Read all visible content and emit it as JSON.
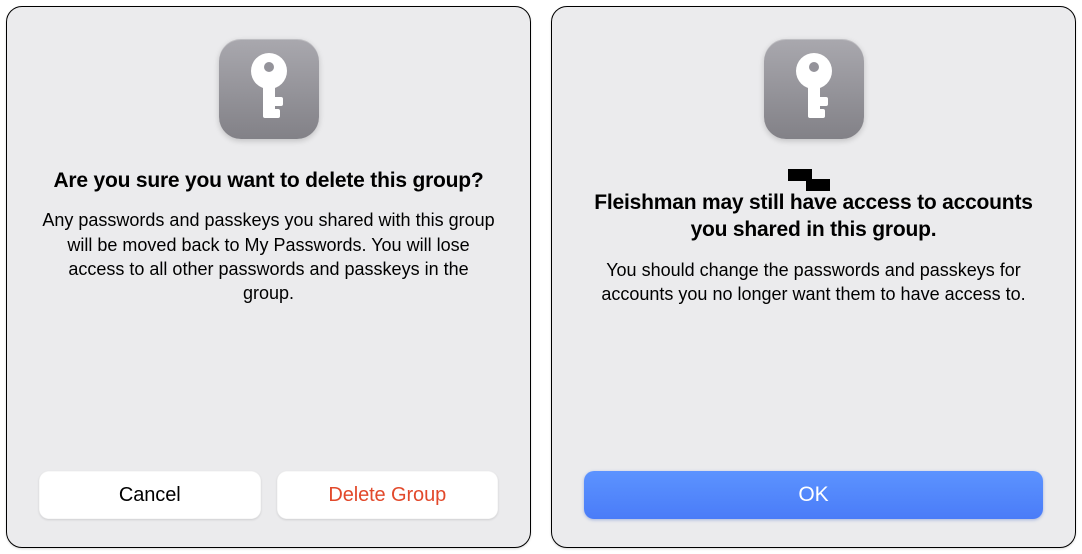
{
  "icons": {
    "app_icon_name": "key-icon"
  },
  "dialog_left": {
    "title": "Are you sure you want to delete this group?",
    "body": "Any passwords and passkeys you shared with this group will be moved back to My Passwords. You will lose access to all other passwords and passkeys in the group.",
    "cancel_label": "Cancel",
    "delete_label": "Delete Group"
  },
  "dialog_right": {
    "title_name_redacted": true,
    "title_suffix": "Fleishman may still have access to accounts you shared in this group.",
    "body": "You should change the passwords and passkeys for accounts you no longer want them to have access to.",
    "ok_label": "OK"
  }
}
